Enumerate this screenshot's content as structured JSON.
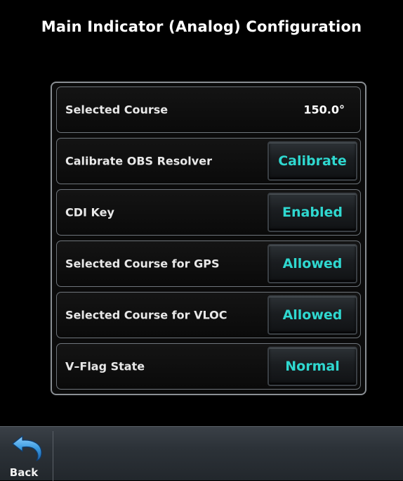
{
  "page": {
    "title": "Main Indicator (Analog) Configuration"
  },
  "settings": {
    "selected_course": {
      "label": "Selected Course",
      "value": "150.0°"
    },
    "calibrate_obs": {
      "label": "Calibrate OBS Resolver",
      "button": "Calibrate"
    },
    "cdi_key": {
      "label": "CDI Key",
      "button": "Enabled"
    },
    "course_gps": {
      "label": "Selected Course for GPS",
      "button": "Allowed"
    },
    "course_vloc": {
      "label": "Selected Course for VLOC",
      "button": "Allowed"
    },
    "v_flag": {
      "label": "V–Flag State",
      "button": "Normal"
    }
  },
  "bottom_bar": {
    "back_label": "Back",
    "back_icon": "back-arrow-icon"
  },
  "colors": {
    "button_text": "#2fd8d0",
    "background": "#000000",
    "back_icon": "#4aa6e8"
  }
}
